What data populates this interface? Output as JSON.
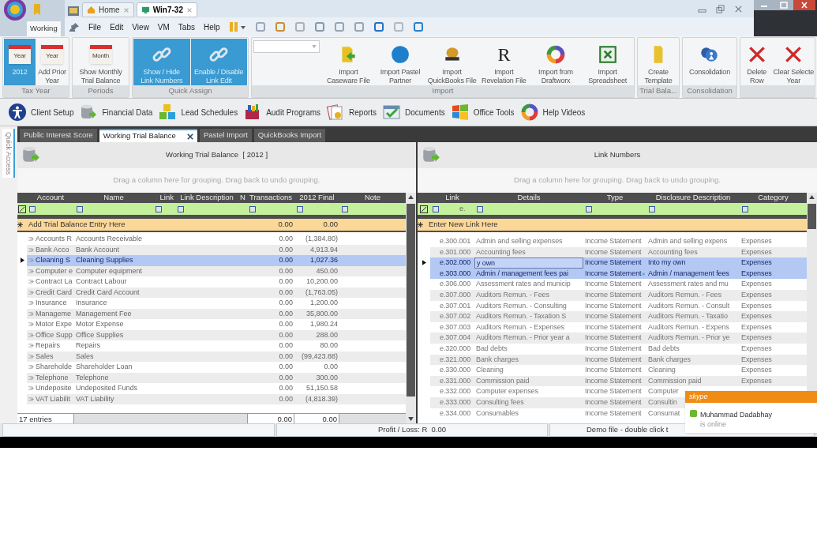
{
  "app_tab": {
    "label": "Working"
  },
  "vm_tabs": [
    {
      "label": "Home",
      "selected": false
    },
    {
      "label": "Win7-32",
      "selected": true
    }
  ],
  "menu": [
    "File",
    "Edit",
    "View",
    "VM",
    "Tabs",
    "Help"
  ],
  "ribbon": {
    "groups": [
      {
        "label": "Tax Year",
        "buttons": [
          {
            "label": "2012",
            "kind": "calendar",
            "icon_text": "Year",
            "selected": true
          },
          {
            "label": "Add Prior\nYear",
            "kind": "calendar",
            "icon_text": "Year",
            "selected": false
          }
        ]
      },
      {
        "label": "Periods",
        "buttons": [
          {
            "label": "Show Monthly\nTrial Balance",
            "kind": "calendar",
            "icon_text": "Month",
            "selected": false
          }
        ]
      },
      {
        "label": "Quick Assign",
        "buttons": [
          {
            "label": "Show / Hide\nLink Numbers",
            "kind": "link",
            "selected": true
          },
          {
            "label": "Enable / Disable\nLink Edit",
            "kind": "link",
            "selected": true
          }
        ]
      },
      {
        "label": "Import",
        "combo": true,
        "buttons": [
          {
            "label": "Import\nCaseware File",
            "kind": "folder-arrow",
            "selected": false
          },
          {
            "label": "Import Pastel\nPartner",
            "kind": "globe",
            "selected": false
          },
          {
            "label": "Import\nQuickBooks File",
            "kind": "coin",
            "selected": false
          },
          {
            "label": "Import\nRevelation File",
            "kind": "letter",
            "icon_text": "R",
            "selected": false
          },
          {
            "label": "Import from\nDraftworx",
            "kind": "ring",
            "selected": false
          },
          {
            "label": "Import\nSpreadsheet",
            "kind": "sheet",
            "selected": false
          }
        ]
      },
      {
        "label": "Trial Bala...",
        "buttons": [
          {
            "label": "Create\nTemplate",
            "kind": "folder-tall",
            "selected": false
          }
        ]
      },
      {
        "label": "Consolidation",
        "buttons": [
          {
            "label": "Consolidation",
            "kind": "people",
            "selected": false
          }
        ]
      },
      {
        "buttons": [
          {
            "label": "Delete\nRow",
            "kind": "cross",
            "selected": false
          },
          {
            "label": "Clear Selecte\nYear",
            "kind": "cross",
            "selected": false
          }
        ]
      }
    ]
  },
  "toolbar": [
    {
      "label": "Client Setup",
      "kind": "person"
    },
    {
      "label": "Financial Data",
      "kind": "database"
    },
    {
      "label": "Lead Schedules",
      "kind": "cubes"
    },
    {
      "label": "Audit Programs",
      "kind": "box"
    },
    {
      "label": "Reports",
      "kind": "pages"
    },
    {
      "label": "Documents",
      "kind": "check"
    },
    {
      "label": "Office Tools",
      "kind": "flag"
    },
    {
      "label": "Help Videos",
      "kind": "ring"
    }
  ],
  "side_strip": {
    "label": "Quick Access"
  },
  "doc_tabs": [
    {
      "label": "Public Interest Score",
      "selected": false
    },
    {
      "label": "Working Trial Balance",
      "selected": true
    },
    {
      "label": "Pastel Import",
      "selected": false
    },
    {
      "label": "QuickBooks Import",
      "selected": false
    }
  ],
  "trial_balance": {
    "title": "Working Trial Balance  [ 2012 ]",
    "group_hint": "Drag a column here for grouping. Drag back to undo grouping.",
    "columns": [
      "Account",
      "Name",
      "Link",
      "Link Description",
      "N",
      "Transactions",
      "2012 Final",
      "Note"
    ],
    "add_row": {
      "label": "Add Trial Balance Entry Here",
      "transactions": "0.00",
      "final": "0.00"
    },
    "rows": [
      {
        "account": "Accounts R",
        "name": "Accounts Receivable",
        "transactions": "0.00",
        "final": "(1,384.80)",
        "selected": false
      },
      {
        "account": "Bank Acco",
        "name": "Bank Account",
        "transactions": "0.00",
        "final": "4,913.94",
        "selected": false
      },
      {
        "account": "Cleaning S",
        "name": "Cleaning Supplies",
        "transactions": "0.00",
        "final": "1,027.36",
        "selected": true
      },
      {
        "account": "Computer e",
        "name": "Computer equipment",
        "transactions": "0.00",
        "final": "450.00",
        "selected": false
      },
      {
        "account": "Contract La",
        "name": "Contract Labour",
        "transactions": "0.00",
        "final": "10,200.00",
        "selected": false
      },
      {
        "account": "Credit Card",
        "name": "Credit Card Account",
        "transactions": "0.00",
        "final": "(1,763.05)",
        "selected": false
      },
      {
        "account": "Insurance",
        "name": "Insurance",
        "transactions": "0.00",
        "final": "1,200.00",
        "selected": false
      },
      {
        "account": "Manageme",
        "name": "Management Fee",
        "transactions": "0.00",
        "final": "35,800.00",
        "selected": false
      },
      {
        "account": "Motor Expe",
        "name": "Motor Expense",
        "transactions": "0.00",
        "final": "1,980.24",
        "selected": false
      },
      {
        "account": "Office Supp",
        "name": "Office Supplies",
        "transactions": "0.00",
        "final": "288.00",
        "selected": false
      },
      {
        "account": "Repairs",
        "name": "Repairs",
        "transactions": "0.00",
        "final": "80.00",
        "selected": false
      },
      {
        "account": "Sales",
        "name": "Sales",
        "transactions": "0.00",
        "final": "(99,423.88)",
        "selected": false
      },
      {
        "account": "Shareholde",
        "name": "Shareholder Loan",
        "transactions": "0.00",
        "final": "0.00",
        "selected": false
      },
      {
        "account": "Telephone",
        "name": "Telephone",
        "transactions": "0.00",
        "final": "300.00",
        "selected": false
      },
      {
        "account": "Undeposite",
        "name": "Undeposited Funds",
        "transactions": "0.00",
        "final": "51,150.58",
        "selected": false
      },
      {
        "account": "VAT Liabilit",
        "name": "VAT Liability",
        "transactions": "0.00",
        "final": "(4,818.39)",
        "selected": false
      }
    ],
    "footer": {
      "count": "17 entries",
      "transactions": "0.00",
      "final": "0.00"
    }
  },
  "link_numbers": {
    "title": "Link Numbers",
    "group_hint": "Drag a column here for grouping. Drag back to undo grouping.",
    "columns": [
      "Link",
      "Details",
      "Type",
      "Disclosure Description",
      "Category"
    ],
    "filter_text": "e.",
    "add_row": {
      "label": "Enter New Link Here"
    },
    "rows": [
      {
        "link": "e.300.001",
        "details": "Admin and selling expenses",
        "type": "Income Statement",
        "disclosure": "Admin and selling expens",
        "category": "Expenses",
        "selected": false,
        "current": false,
        "editing": false,
        "dropdown": false
      },
      {
        "link": "e.301.000",
        "details": "Accounting fees",
        "type": "Income Statement",
        "disclosure": "Accounting fees",
        "category": "Expenses",
        "selected": false,
        "current": false,
        "editing": false,
        "dropdown": false
      },
      {
        "link": "e.302.000",
        "details": "y own",
        "type": "Income Statement",
        "disclosure": "Into my own",
        "category": "Expenses",
        "selected": true,
        "current": true,
        "editing": true,
        "dropdown": false
      },
      {
        "link": "e.303.000",
        "details": "Admin / management fees pai",
        "type": "Income Statement",
        "disclosure": "Admin / management fees",
        "category": "Expenses",
        "selected": true,
        "current": false,
        "editing": false,
        "dropdown": true
      },
      {
        "link": "e.306.000",
        "details": "Assessment rates and municip",
        "type": "Income Statement",
        "disclosure": "Assessment rates and mu",
        "category": "Expenses",
        "selected": false,
        "current": false,
        "editing": false,
        "dropdown": false
      },
      {
        "link": "e.307.000",
        "details": "Auditors Remun. - Fees",
        "type": "Income Statement",
        "disclosure": "Auditors Remun. - Fees",
        "category": "Expenses",
        "selected": false,
        "current": false,
        "editing": false,
        "dropdown": false
      },
      {
        "link": "e.307.001",
        "details": "Auditors Remun. - Consulting",
        "type": "Income Statement",
        "disclosure": "Auditors Remun. - Consult",
        "category": "Expenses",
        "selected": false,
        "current": false,
        "editing": false,
        "dropdown": false
      },
      {
        "link": "e.307.002",
        "details": "Auditors Remun. - Taxation S",
        "type": "Income Statement",
        "disclosure": "Auditors Remun. - Taxatio",
        "category": "Expenses",
        "selected": false,
        "current": false,
        "editing": false,
        "dropdown": false
      },
      {
        "link": "e.307.003",
        "details": "Auditors Remun. - Expenses",
        "type": "Income Statement",
        "disclosure": "Auditors Remun. - Expens",
        "category": "Expenses",
        "selected": false,
        "current": false,
        "editing": false,
        "dropdown": false
      },
      {
        "link": "e.307.004",
        "details": "Auditors Remun. - Prior year a",
        "type": "Income Statement",
        "disclosure": "Auditors Remun. - Prior ye",
        "category": "Expenses",
        "selected": false,
        "current": false,
        "editing": false,
        "dropdown": false
      },
      {
        "link": "e.320.000",
        "details": "Bad debts",
        "type": "Income Statement",
        "disclosure": "Bad debts",
        "category": "Expenses",
        "selected": false,
        "current": false,
        "editing": false,
        "dropdown": false
      },
      {
        "link": "e.321.000",
        "details": "Bank charges",
        "type": "Income Statement",
        "disclosure": "Bank charges",
        "category": "Expenses",
        "selected": false,
        "current": false,
        "editing": false,
        "dropdown": false
      },
      {
        "link": "e.330.000",
        "details": "Cleaning",
        "type": "Income Statement",
        "disclosure": "Cleaning",
        "category": "Expenses",
        "selected": false,
        "current": false,
        "editing": false,
        "dropdown": false
      },
      {
        "link": "e.331.000",
        "details": "Commission paid",
        "type": "Income Statement",
        "disclosure": "Commission paid",
        "category": "Expenses",
        "selected": false,
        "current": false,
        "editing": false,
        "dropdown": false
      },
      {
        "link": "e.332.000",
        "details": "Computer expenses",
        "type": "Income Statement",
        "disclosure": "Computer",
        "selected": false,
        "current": false,
        "editing": false,
        "dropdown": false
      },
      {
        "link": "e.333.000",
        "details": "Consulting fees",
        "type": "Income Statement",
        "disclosure": "Consultin",
        "selected": false,
        "current": false,
        "editing": false,
        "dropdown": false
      },
      {
        "link": "e.334.000",
        "details": "Consumables",
        "type": "Income Statement",
        "disclosure": "Consumat",
        "selected": false,
        "current": false,
        "editing": false,
        "dropdown": false
      }
    ]
  },
  "status_bar": {
    "profit": "Profit / Loss: R  0.00",
    "note": "Demo file - double click t"
  },
  "notification": {
    "brand": "skype",
    "name": "Muhammad Dadabhay",
    "status": "is online"
  }
}
